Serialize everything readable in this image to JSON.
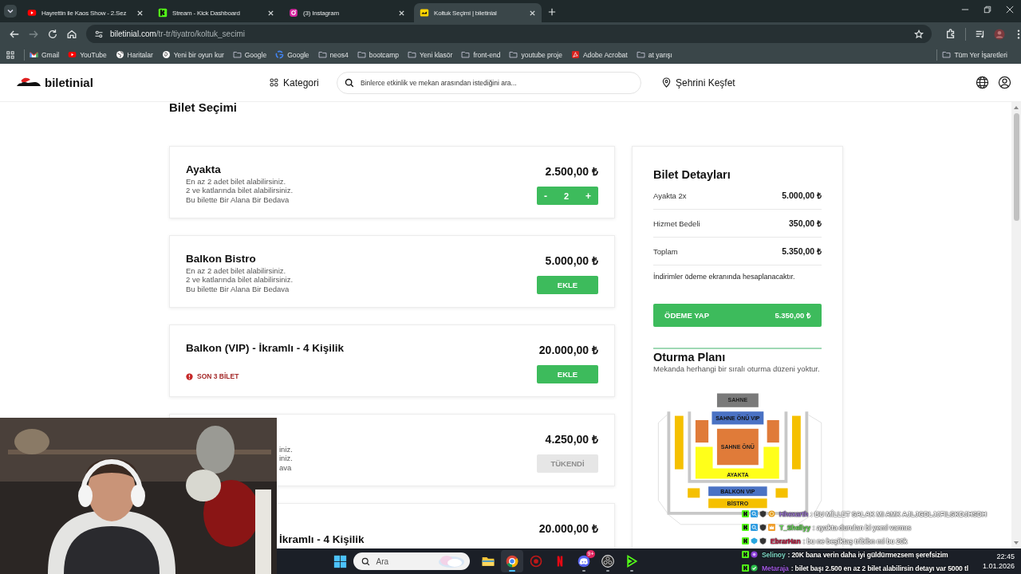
{
  "browser": {
    "tabs": [
      {
        "title": "Hayrettin ile Kaos Show - 2.Sez",
        "kind": "youtube",
        "selected": false
      },
      {
        "title": "Stream - Kick Dashboard",
        "kind": "kick",
        "selected": false
      },
      {
        "title": "(3) Instagram",
        "kind": "instagram",
        "selected": false
      },
      {
        "title": "Koltuk Seçimi | biletinial",
        "kind": "biletinial",
        "selected": true
      }
    ],
    "url_host": "biletinial.com",
    "url_path": "/tr-tr/tiyatro/koltuk_secimi",
    "bookmarks": [
      {
        "label": "Gmail",
        "kind": "gmail"
      },
      {
        "label": "YouTube",
        "kind": "youtube"
      },
      {
        "label": "Haritalar",
        "kind": "globe"
      },
      {
        "label": "Yeni bir oyun kur",
        "kind": "swirl"
      },
      {
        "label": "Google",
        "kind": "folder"
      },
      {
        "label": "Google",
        "kind": "google"
      },
      {
        "label": "neos4",
        "kind": "folder"
      },
      {
        "label": "bootcamp",
        "kind": "folder"
      },
      {
        "label": "Yeni klasör",
        "kind": "folder"
      },
      {
        "label": "front-end",
        "kind": "folder"
      },
      {
        "label": "youtube proje",
        "kind": "folder"
      },
      {
        "label": "Adobe Acrobat",
        "kind": "acrobat"
      },
      {
        "label": "at yarışı",
        "kind": "folder"
      }
    ],
    "all_bookmarks": "Tüm Yer İşaretleri"
  },
  "site_header": {
    "logo": "biletinial",
    "category": "Kategori",
    "search_placeholder": "Binlerce etkinlik ve mekan arasından istediğini ara...",
    "city": "Şehrini Keşfet"
  },
  "page_title": "Bilet Seçimi",
  "tickets": [
    {
      "title": "Ayakta",
      "lines": [
        "En az 2 adet bilet alabilirsiniz.",
        "2 ve katlarında bilet alabilirsiniz.",
        "Bu bilette Bir Alana Bir Bedava"
      ],
      "price": "2.500,00 ₺",
      "action": {
        "kind": "stepper",
        "minus": "-",
        "quantity": "2",
        "plus": "+"
      }
    },
    {
      "title": "Balkon Bistro",
      "lines": [
        "En az 2 adet bilet alabilirsiniz.",
        "2 ve katlarında bilet alabilirsiniz.",
        "Bu bilette Bir Alana Bir Bedava"
      ],
      "price": "5.000,00 ₺",
      "action": {
        "kind": "button",
        "label": "EKLE",
        "disabled": false
      }
    },
    {
      "title": "Balkon (VIP) - İkramlı - 4 Kişilik",
      "warning": "SON 3 BİLET",
      "price": "20.000,00 ₺",
      "action": {
        "kind": "button",
        "label": "EKLE",
        "disabled": false
      }
    },
    {
      "covered": true,
      "lines": [
        "iniz.",
        "iniz.",
        "ava"
      ],
      "price": "4.250,00 ₺",
      "action": {
        "kind": "button",
        "label": "TÜKENDİ",
        "disabled": true
      }
    },
    {
      "covered": true,
      "title": "İkramlı - 4 Kişilik",
      "price": "20.000,00 ₺"
    }
  ],
  "details": {
    "title": "Bilet Detayları",
    "rows": [
      {
        "label": "Ayakta 2x",
        "value": "5.000,00 ₺"
      },
      {
        "label": "Hizmet Bedeli",
        "value": "350,00 ₺"
      },
      {
        "label": "Toplam",
        "value": "5.350,00 ₺"
      }
    ],
    "note": "İndirimler ödeme ekranında hesaplanacaktır.",
    "pay_label": "ÖDEME YAP",
    "pay_amount": "5.350,00 ₺"
  },
  "seating": {
    "title": "Oturma Planı",
    "text": "Mekanda herhangi bir sıralı oturma düzeni yoktur.",
    "map_labels": [
      "SAHNE",
      "SAHNE ÖNÜ VIP",
      "SAHNE ÖNÜ",
      "AYAKTA",
      "BALKON VIP",
      "BİSTRO"
    ]
  },
  "chat": [
    {
      "user": "Hhexarth",
      "color": "#a07ad8",
      "message": ": BU MİLLET SALAK MI AMK AJLJGDLJJFILSKDJHSDH",
      "badges": [
        {
          "kind": "kick"
        },
        {
          "kind": "search"
        },
        {
          "kind": "shield"
        },
        {
          "kind": "coin"
        }
      ]
    },
    {
      "user": "T_Shellyy",
      "color": "#66dd55",
      "message": ": ayakta durulan bi yemi varmıs",
      "badges": [
        {
          "kind": "kick"
        },
        {
          "kind": "search"
        },
        {
          "kind": "shield"
        },
        {
          "kind": "crown"
        }
      ]
    },
    {
      "user": "EbrarHan",
      "color": "#c8234a",
      "message": ": bu ne beşiktaş tribibn mi bu 20k",
      "badges": [
        {
          "kind": "kick"
        },
        {
          "kind": "gem"
        },
        {
          "kind": "shield"
        }
      ]
    },
    {
      "user": "Selinoy",
      "color": "#7fd9c8",
      "message": ": 20K bana verin daha iyi güldürmezsem şerefsizim",
      "badges": [
        {
          "kind": "kick"
        },
        {
          "kind": "dot"
        }
      ]
    },
    {
      "user": "Metaraja",
      "color": "#a55ee8",
      "message": ": bilet başı 2.500 en az 2 bilet alabilirsin detayı var 5000 tl",
      "badges": [
        {
          "kind": "kick"
        },
        {
          "kind": "check"
        }
      ]
    }
  ],
  "taskbar": {
    "search_placeholder": "Ara",
    "apps": [
      {
        "kind": "files",
        "active": false,
        "running": false
      },
      {
        "kind": "chrome",
        "active": true,
        "running": true
      },
      {
        "kind": "gear",
        "active": false,
        "running": false
      },
      {
        "kind": "netflix",
        "active": false,
        "running": false
      },
      {
        "kind": "discord",
        "active": false,
        "running": true,
        "badge": "9+"
      },
      {
        "kind": "obs",
        "active": false,
        "running": true
      },
      {
        "kind": "kick",
        "active": false,
        "running": true
      }
    ],
    "time": "22:45",
    "date": "1.01.2026"
  }
}
